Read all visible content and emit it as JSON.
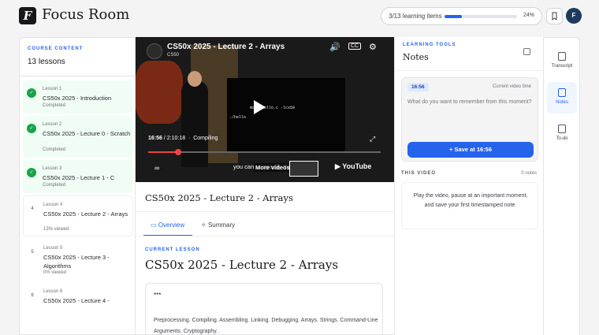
{
  "app": {
    "logo_letter": "F",
    "title": "Focus Room"
  },
  "progress": {
    "text": "3/13 learning items",
    "percent_label": "24%",
    "fraction": 0.24
  },
  "user": {
    "avatar_letter": "F"
  },
  "sidebar": {
    "section_label": "COURSE CONTENT",
    "count_label": "13 lessons",
    "lessons": [
      {
        "num": "",
        "meta": "Lesson 1",
        "title": "CS50x 2025 - Introduction",
        "status": "Completed",
        "done": true
      },
      {
        "num": "",
        "meta": "Lesson 2",
        "title": "CS50x 2025 - Lecture 0 - Scratch",
        "status": "Completed",
        "done": true
      },
      {
        "num": "",
        "meta": "Lesson 3",
        "title": "CS50x 2025 - Lecture 1 - C",
        "status": "Completed",
        "done": true
      },
      {
        "num": "4",
        "meta": "Lesson 4",
        "title": "CS50x 2025 - Lecture 2 - Arrays",
        "status": "13% viewed",
        "done": false
      },
      {
        "num": "5",
        "meta": "Lesson 5",
        "title": "CS50x 2025 - Lecture 3 - Algorithms",
        "status": "0% viewed",
        "done": false
      },
      {
        "num": "6",
        "meta": "Lesson 6",
        "title": "CS50x 2025 - Lecture 4 -",
        "status": "",
        "done": false
      }
    ]
  },
  "video": {
    "title": "CS50x 2025 - Lecture 2 - Arrays",
    "channel": "CS50",
    "current_time": "16:56",
    "duration": "2:10:18",
    "chapter": "Compiling",
    "played_fraction": 0.13,
    "caption": "you can … specify the file name",
    "more_videos": "More videos",
    "platform": "YouTube",
    "screen_line1": "make hello.c -lcs50",
    "screen_line2": "./hello"
  },
  "main": {
    "heading": "CS50x 2025 - Lecture 2 - Arrays",
    "tabs": [
      {
        "label": "Overview"
      },
      {
        "label": "Summary"
      }
    ],
    "current_label": "CURRENT LESSON",
    "current_title": "CS50x 2025 - Lecture 2 - Arrays",
    "card_dots": "***",
    "card_text": "Preprocessing. Compiling. Assembling. Linking. Debugging. Arrays. Strings. Command-Line Arguments. Cryptography."
  },
  "tools": {
    "section_label": "LEARNING TOOLS",
    "title": "Notes",
    "note_time": "16:56",
    "note_time_label": "Current video time",
    "note_placeholder": "What do you want to remember from this moment?",
    "save_label": "+ Save at 16:56",
    "this_video_label": "THIS VIDEO",
    "note_count": "0 notes",
    "empty_text": "Play the video, pause at an important moment, and save your first timestamped note."
  },
  "rail": [
    {
      "label": "Transcript"
    },
    {
      "label": "Notes"
    },
    {
      "label": "To-do"
    }
  ],
  "colors": {
    "accent": "#2563eb",
    "done": "#16a34a",
    "done_bg": "#f0fdf4"
  }
}
